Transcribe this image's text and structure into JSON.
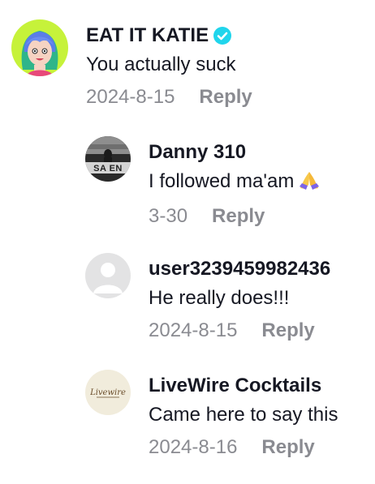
{
  "comments": [
    {
      "username": "EAT IT KATIE",
      "verified": true,
      "text": "You actually suck",
      "date": "2024-8-15",
      "reply_label": "Reply",
      "avatar_icon": "cartoon-woman-icon"
    },
    {
      "username": "Danny 310",
      "text": "I followed ma'am",
      "emoji_icon": "folded-hands-icon",
      "date": "3-30",
      "reply_label": "Reply",
      "avatar_icon": "photo-avatar"
    },
    {
      "username": "user3239459982436",
      "text": "He really does!!!",
      "date": "2024-8-15",
      "reply_label": "Reply",
      "avatar_icon": "default-user-icon"
    },
    {
      "username": "LiveWire Cocktails",
      "text": "Came here to say this",
      "date": "2024-8-16",
      "reply_label": "Reply",
      "avatar_icon": "livewire-logo",
      "avatar_logo_text": "Livewire"
    }
  ],
  "colors": {
    "text": "#161823",
    "muted": "#8a8b91",
    "verified": "#20d5ec",
    "avatar_green": "#c6f23a"
  }
}
